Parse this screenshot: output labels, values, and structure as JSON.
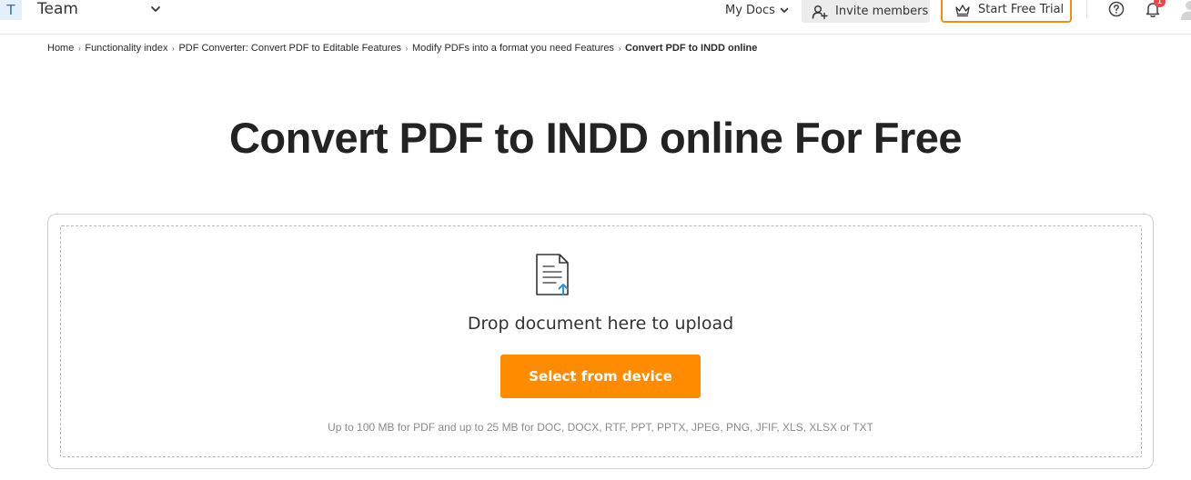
{
  "topbar": {
    "team_initial": "T",
    "team_name": "Team",
    "my_docs_label": "My Docs",
    "invite_label": "Invite members",
    "trial_label": "Start Free Trial",
    "notification_count": "1"
  },
  "breadcrumb": {
    "items": [
      "Home",
      "Functionality index",
      "PDF Converter: Convert PDF to Editable Features",
      "Modify PDFs into a format you need Features",
      "Convert PDF to INDD online"
    ]
  },
  "main": {
    "title": "Convert PDF to INDD online For Free",
    "drop_text": "Drop document here to upload",
    "select_button": "Select from device",
    "limits_text": "Up to 100 MB for PDF and up to 25 MB for DOC, DOCX, RTF, PPT, PPTX, JPEG, PNG, JFIF, XLS, XLSX or TXT"
  },
  "colors": {
    "accent_orange": "#ff8c00",
    "trial_border": "#f18d1b",
    "upload_arrow": "#2f8fd8",
    "badge_red": "#e5484d"
  }
}
